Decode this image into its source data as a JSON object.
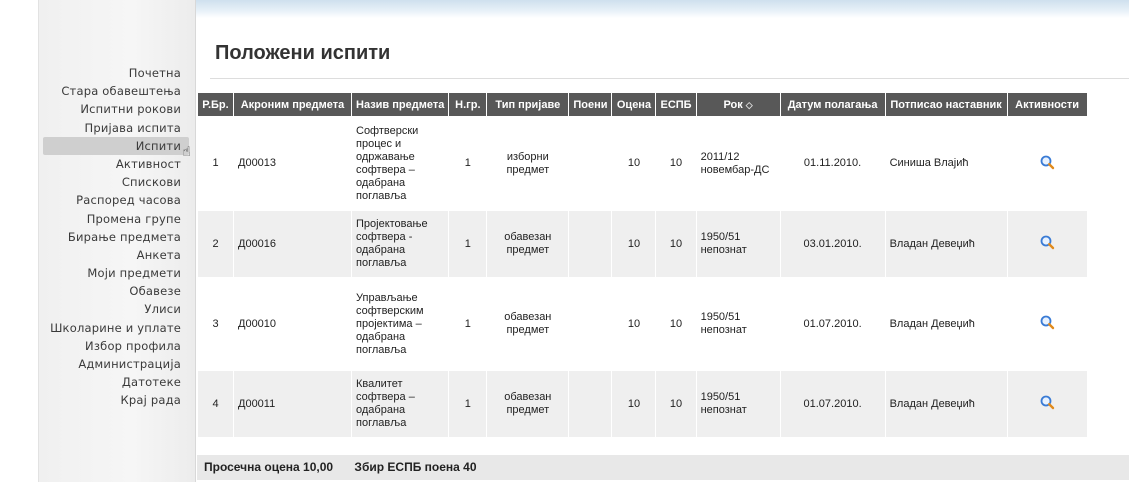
{
  "sidebar": {
    "items": [
      {
        "label": "Почетна"
      },
      {
        "label": "Стара обавештења"
      },
      {
        "label": "Испитни рокови"
      },
      {
        "label": "Пријава испита"
      },
      {
        "label": "Испити",
        "active": true
      },
      {
        "label": "Активност"
      },
      {
        "label": "Спискови"
      },
      {
        "label": "Распоред часова"
      },
      {
        "label": "Промена групе"
      },
      {
        "label": "Бирање предмета"
      },
      {
        "label": "Анкета"
      },
      {
        "label": "Моји предмети"
      },
      {
        "label": "Обавезе"
      },
      {
        "label": "Улиси"
      },
      {
        "label": "Школарине и уплате"
      },
      {
        "label": "Избор профила"
      },
      {
        "label": "Администрација"
      },
      {
        "label": "Датотеке"
      },
      {
        "label": "Крај рада"
      }
    ]
  },
  "main": {
    "title": "Положени испити",
    "columns": [
      "Р.Бр.",
      "Акроним предмета",
      "Назив предмета",
      "Н.гр.",
      "Тип пријаве",
      "Поени",
      "Оцена",
      "ЕСПБ",
      "Рок",
      "Датум полагања",
      "Потписао наставник",
      "Активности"
    ],
    "rows": [
      {
        "rbr": "1",
        "acronym": "Д00013",
        "name": "Софтверски процес и одржавање софтвера – одабрана поглавља",
        "ngr": "1",
        "type": "изборни предмет",
        "points": "",
        "grade": "10",
        "espb": "10",
        "term": "2011/12 новембар-ДС",
        "date": "01.11.2010.",
        "teacher": "Синиша Влајић"
      },
      {
        "rbr": "2",
        "acronym": "Д00016",
        "name": "Пројектовање софтвера - одабрана поглавља",
        "ngr": "1",
        "type": "обавезан предмет",
        "points": "",
        "grade": "10",
        "espb": "10",
        "term": "1950/51 непознат",
        "date": "03.01.2010.",
        "teacher": "Владан Девеџић"
      },
      {
        "rbr": "3",
        "acronym": "Д00010",
        "name": "Управљање софтверским пројектима – одабрана поглавља",
        "ngr": "1",
        "type": "обавезан предмет",
        "points": "",
        "grade": "10",
        "espb": "10",
        "term": "1950/51 непознат",
        "date": "01.07.2010.",
        "teacher": "Владан Девеџић"
      },
      {
        "rbr": "4",
        "acronym": "Д00011",
        "name": "Квалитет софтвера – одабрана поглавља",
        "ngr": "1",
        "type": "обавезан предмет",
        "points": "",
        "grade": "10",
        "espb": "10",
        "term": "1950/51 непознат",
        "date": "01.07.2010.",
        "teacher": "Владан Девеџић"
      }
    ],
    "footer": {
      "average": "Просечна оцена 10,00",
      "espb_sum": "Збир ЕСПБ поена 40"
    },
    "icons": {
      "sort": "sort-arrow-icon",
      "details": "magnifier-icon"
    },
    "colors": {
      "header_bg": "#585858",
      "even_row": "#efefef",
      "footer_bg": "#e8e8e8"
    }
  }
}
